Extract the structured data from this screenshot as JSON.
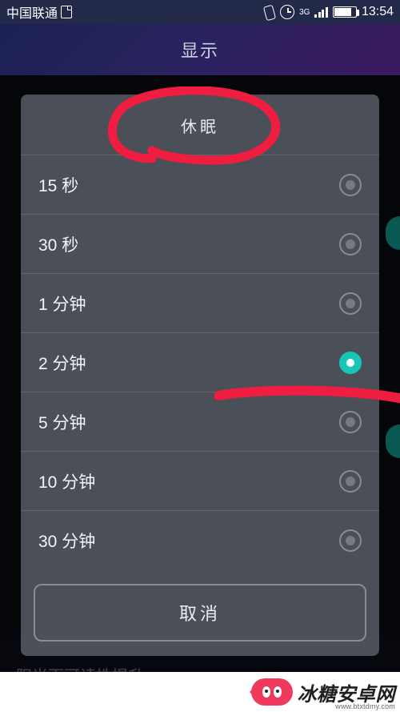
{
  "status_bar": {
    "carrier": "中国联通",
    "network_indicator": "3G",
    "time": "13:54"
  },
  "header": {
    "title": "显示"
  },
  "background_rows": {
    "sunlight": "阳光下可读性提升"
  },
  "dialog": {
    "title": "休眠",
    "options": [
      {
        "label": "15 秒",
        "selected": false
      },
      {
        "label": "30 秒",
        "selected": false
      },
      {
        "label": "1 分钟",
        "selected": false
      },
      {
        "label": "2 分钟",
        "selected": true
      },
      {
        "label": "5 分钟",
        "selected": false
      },
      {
        "label": "10 分钟",
        "selected": false
      },
      {
        "label": "30 分钟",
        "selected": false
      }
    ],
    "cancel_label": "取消"
  },
  "watermark": {
    "brand": "冰糖安卓网",
    "url": "www.btxtdmy.com"
  }
}
